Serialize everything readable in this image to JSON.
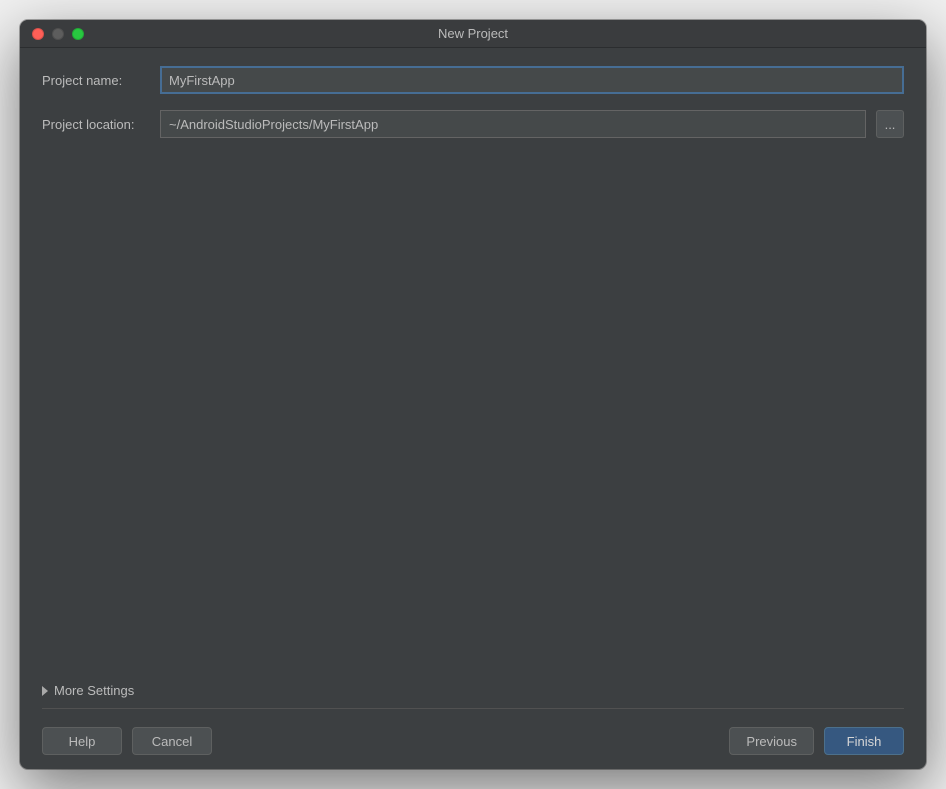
{
  "window": {
    "title": "New Project"
  },
  "form": {
    "project_name_label": "Project name:",
    "project_name_value": "MyFirstApp",
    "project_location_label": "Project location:",
    "project_location_value": "~/AndroidStudioProjects/MyFirstApp",
    "browse_label": "..."
  },
  "more_settings_label": "More Settings",
  "buttons": {
    "help": "Help",
    "cancel": "Cancel",
    "previous": "Previous",
    "finish": "Finish"
  }
}
